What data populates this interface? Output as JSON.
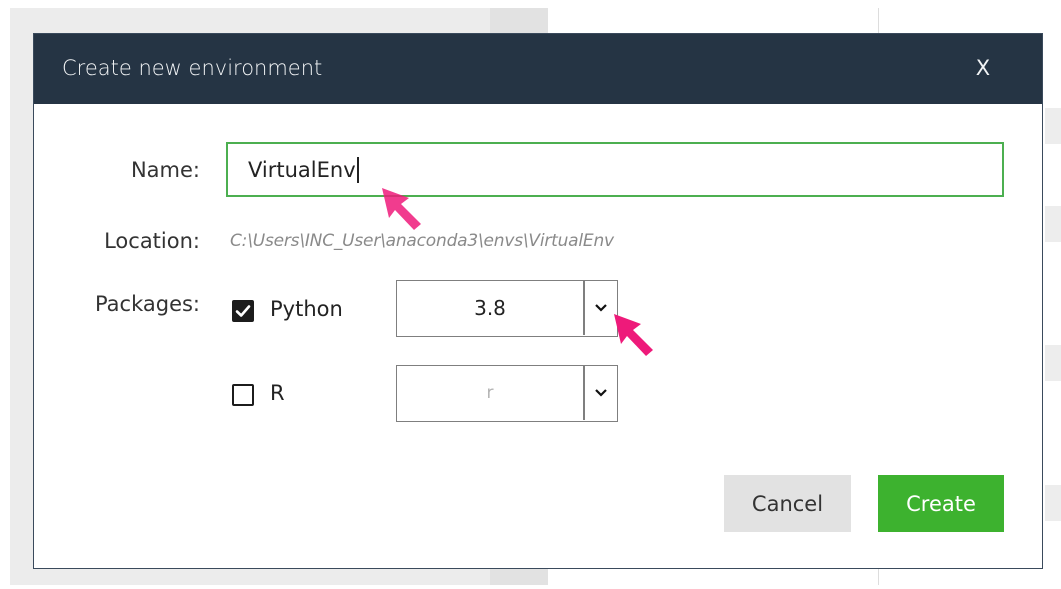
{
  "dialog": {
    "title": "Create new environment",
    "close_label": "X"
  },
  "form": {
    "name_label": "Name:",
    "name_value": "VirtualEnv",
    "location_label": "Location:",
    "location_value": "C:\\Users\\INC_User\\anaconda3\\envs\\VirtualEnv",
    "packages_label": "Packages:",
    "packages": [
      {
        "name": "Python",
        "checked": true,
        "version": "3.8"
      },
      {
        "name": "R",
        "checked": false,
        "version": "r"
      }
    ]
  },
  "buttons": {
    "cancel": "Cancel",
    "create": "Create"
  },
  "colors": {
    "titlebar": "#253444",
    "accent_green": "#3db22f",
    "input_border": "#4caf50",
    "pointer": "#ee1a7a"
  }
}
